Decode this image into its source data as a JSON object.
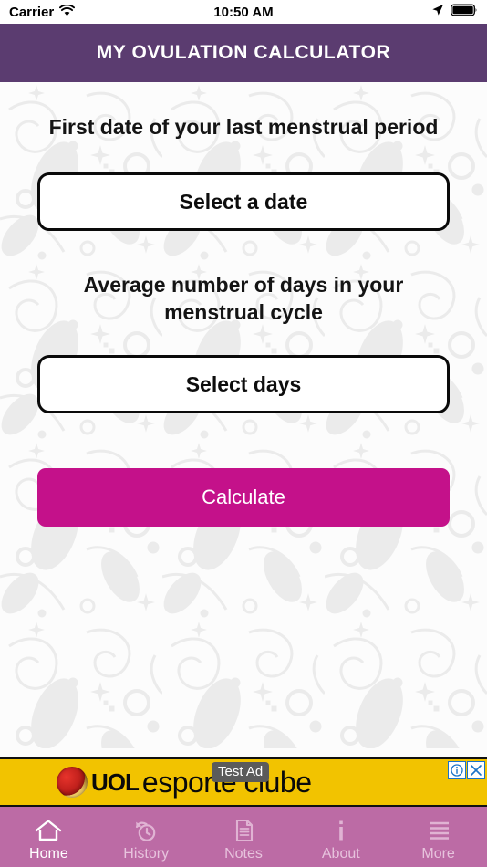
{
  "statusbar": {
    "carrier": "Carrier",
    "wifi_icon": "wifi-icon",
    "time": "10:50 AM",
    "location_icon": "location-arrow-icon",
    "battery_icon": "battery-full-icon"
  },
  "header": {
    "title": "MY OVULATION CALCULATOR",
    "background_color": "#5b3c70"
  },
  "main": {
    "lmp_label": "First date of your last menstrual period",
    "select_date_button": "Select a date",
    "cycle_label": "Average number of days in your menstrual cycle",
    "select_days_button": "Select days",
    "calculate_button": "Calculate",
    "calculate_color": "#c4118a"
  },
  "ad": {
    "brand": "UOL",
    "tagline": "esporte clube",
    "badge": "Test Ad",
    "background_color": "#f2c300",
    "info_icon": "info-circle-icon",
    "close_icon": "close-x-icon"
  },
  "tabbar": {
    "background_color": "#bc6ba5",
    "items": [
      {
        "label": "Home",
        "icon": "home-icon",
        "active": true
      },
      {
        "label": "History",
        "icon": "history-icon",
        "active": false
      },
      {
        "label": "Notes",
        "icon": "notes-icon",
        "active": false
      },
      {
        "label": "About",
        "icon": "info-icon",
        "active": false
      },
      {
        "label": "More",
        "icon": "menu-icon",
        "active": false
      }
    ]
  }
}
